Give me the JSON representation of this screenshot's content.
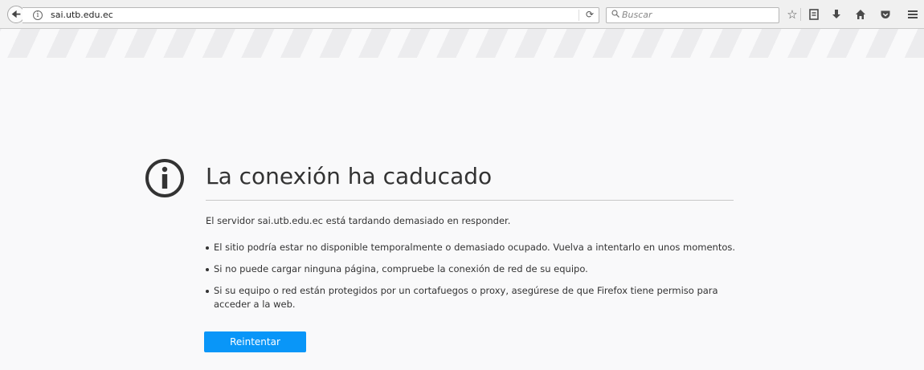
{
  "toolbar": {
    "url": "sai.utb.edu.ec",
    "search_placeholder": "Buscar",
    "icons": [
      "back-arrow-icon",
      "info-icon",
      "reload-icon",
      "search-icon",
      "bookmark-star-icon",
      "reading-list-icon",
      "download-icon",
      "home-icon",
      "pocket-icon",
      "menu-icon"
    ]
  },
  "error": {
    "title": "La conexión ha caducado",
    "description": "El servidor sai.utb.edu.ec está tardando demasiado en responder.",
    "bullets": [
      "El sitio podría estar no disponible temporalmente o demasiado ocupado. Vuelva a intentarlo en unos momentos.",
      "Si no puede cargar ninguna página, compruebe la conexión de red de su equipo.",
      "Si su equipo o red están protegidos por un cortafuegos o proxy, asegúrese de que Firefox tiene permiso para acceder a la web."
    ],
    "retry_label": "Reintentar"
  },
  "colors": {
    "accent": "#0996f8",
    "background": "#f9f9fa"
  }
}
